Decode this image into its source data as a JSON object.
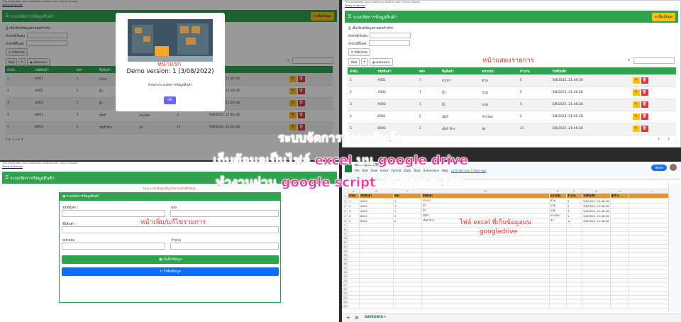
{
  "apps_notice": "This application was created by another user, not by Google.",
  "terms": "Terms of Service",
  "app_title": "ระบบจัดการข้อมูลสินค้า",
  "add_button": "+เพิ่มข้อมูล",
  "filter": {
    "heading": "เลือกฟิลด์ข้อมูลตามต่อสำหรับ",
    "field1_label": "ลำดับที่เริ่มต้น",
    "field2_label": "ลำดับที่สิ้นสุด",
    "reset_label": "รีเซ็ตลำดับ"
  },
  "tools": {
    "print": "พิมพ์",
    "dropdown": "▾",
    "columns": "แสดงเฉพาะ"
  },
  "table": {
    "columns": [
      "ลำดับ",
      "รหัสสินค้า",
      "หลัง",
      "ชื่อสินค้า",
      "หน่วยนับ",
      "จำนวน",
      "วันที่บันทึก"
    ],
    "rows": [
      [
        "1",
        "A001",
        "1",
        "ปากกา",
        "ด้าม",
        "5",
        "3/8/2022, 21:46:28"
      ],
      [
        "2",
        "A002",
        "1",
        "น้ำ",
        "ขวด",
        "5",
        "3/8/2022, 21:46:28"
      ],
      [
        "3",
        "A003",
        "1",
        "น้ำ",
        "ขวด",
        "3",
        "3/8/2022, 21:46:28"
      ],
      [
        "4",
        "B001",
        "2",
        "เบียร์",
        "กระป๋อง",
        "2",
        "3/8/2022, 21:46:28"
      ],
      [
        "5",
        "B002",
        "2",
        "เบียร์ ช้าง",
        "ลัง",
        "11",
        "3/8/2022, 21:46:28"
      ]
    ],
    "modal_rows": [
      [
        "1",
        "A001",
        "1",
        "ปากก",
        "",
        "",
        "5/8/2022, 21:46:28"
      ],
      [
        "2",
        "A002",
        "1",
        "น้ำ",
        "",
        "",
        "5/8/2022, 21:46:28"
      ],
      [
        "3",
        "A003",
        "1",
        "น้ำ",
        "",
        "",
        "5/8/2022, 21:46:28"
      ],
      [
        "4",
        "B001",
        "2",
        "เบียร์",
        "กระป๋อง",
        "2",
        "5/8/2022, 21:46:28"
      ],
      [
        "5",
        "B002",
        "2",
        "เบียร์ ช้าง",
        "ลัง",
        "11",
        "5/8/2022, 21:46:28"
      ]
    ],
    "edit_icon": "✎",
    "delete_icon": "🗑"
  },
  "pager_text": "1 ถึง 5 จาก 5",
  "pager_prev": "‹",
  "pager_next": "›",
  "modal": {
    "version": "Demo version: 1 (3/08/2022)",
    "desc": "ตัวอย่างระบบจัดการข้อมูลสินค้า",
    "ok": "OK"
  },
  "form": {
    "card_title": "ระบบจัดการข้อมูลสินค้า",
    "note": "กรุณากรอกข้อมูลให้ถูกต้องก่อนบันทึกข้อมูล",
    "label_code": "รหัสสินค้า :",
    "label_shelf": "หลัง",
    "label_name": "ชื่อสินค้า :",
    "label_unit": "หน่วยนับ",
    "label_qty": "จำนวน",
    "save": "บันทึกข้อมูล",
    "reset": "รีเซ็ตข้อมูล"
  },
  "sheet": {
    "filename": "example CRUD",
    "menus": [
      "File",
      "Edit",
      "View",
      "Insert",
      "Format",
      "Data",
      "Tools",
      "Extensions",
      "Help"
    ],
    "last_edit": "Last edit was 2 days ago",
    "share": "Share",
    "col_letters": [
      "A",
      "B",
      "C",
      "D",
      "E",
      "F",
      "G",
      "H",
      "I"
    ],
    "header_row": [
      "ลำดับ",
      "รหัสสินค้า",
      "หลัง",
      "ชื่อสินค้า",
      "หน่วยนับ",
      "จำนวน",
      "วันที่บันทึก",
      "ผู้สร้าง"
    ],
    "data_rows": [
      [
        "1",
        "A001",
        "1",
        "ปากกา",
        "ด้าม",
        "5",
        "3/8/2022, 21:46:28",
        ""
      ],
      [
        "2",
        "A002",
        "1",
        "น้ำ",
        "ขวด",
        "5",
        "3/8/2022, 21:46:28",
        ""
      ],
      [
        "3",
        "A003",
        "1",
        "น้ำ",
        "ขวด",
        "3",
        "3/8/2022, 21:46:28",
        ""
      ],
      [
        "4",
        "B001",
        "2",
        "เบียร์",
        "กระป๋อง",
        "2",
        "3/8/2022, 21:46:28",
        ""
      ],
      [
        "5",
        "B002",
        "2",
        "เบียร์ ช้าง",
        "ลัง",
        "11",
        "3/8/2022, 21:46:28",
        ""
      ]
    ],
    "tab_name": "SAVEDATA"
  },
  "annotations": {
    "first_page": "หน้าแรก",
    "list_page": "หน้าแสดงรายการ",
    "edit_page": "หน้าเพิ่ม/แก้ไขรายการ",
    "excel_note_1": "ไฟล์ excel ที่เก็บข้อมูลบน",
    "excel_note_2": "googledrive",
    "title_1": "ระบบจัดการข้อมูลสินค้า",
    "title_2": "เก็บข้อมูลเป็นไฟล์ excel บน google drive",
    "title_3": "ทำงานผ่าน google script ไม่เสียรายเดือน"
  },
  "colors": {
    "primary": "#2ea44f",
    "warning": "#ffc107",
    "danger": "#dc3545",
    "annotation": "#ff3030",
    "headline": "#ff2e9a",
    "sheet_header": "#e8942c"
  }
}
